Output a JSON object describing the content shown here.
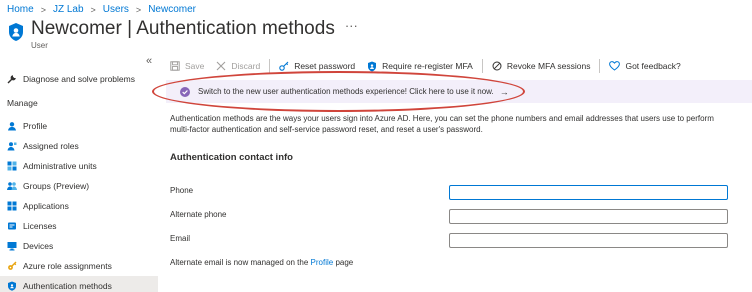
{
  "breadcrumb": [
    "Home",
    "JZ Lab",
    "Users",
    "Newcomer"
  ],
  "header": {
    "title": "Newcomer | Authentication methods",
    "ellipsis": "···",
    "subtitle": "User"
  },
  "collapse_glyph": "«",
  "sidebar": {
    "top_item": {
      "label": "Diagnose and solve problems",
      "icon": "wrench-icon"
    },
    "section": "Manage",
    "items": [
      {
        "label": "Profile",
        "icon": "profile-icon"
      },
      {
        "label": "Assigned roles",
        "icon": "assigned-roles-icon"
      },
      {
        "label": "Administrative units",
        "icon": "admin-units-icon"
      },
      {
        "label": "Groups (Preview)",
        "icon": "groups-icon"
      },
      {
        "label": "Applications",
        "icon": "applications-icon"
      },
      {
        "label": "Licenses",
        "icon": "licenses-icon"
      },
      {
        "label": "Devices",
        "icon": "devices-icon"
      },
      {
        "label": "Azure role assignments",
        "icon": "key-icon"
      },
      {
        "label": "Authentication methods",
        "icon": "shield-icon",
        "active": true
      }
    ]
  },
  "toolbar": {
    "save": "Save",
    "discard": "Discard",
    "reset_password": "Reset password",
    "require_mfa": "Require re-register MFA",
    "revoke_mfa": "Revoke MFA sessions",
    "feedback": "Got feedback?"
  },
  "banner": {
    "text": "Switch to the new user authentication methods experience! Click here to use it now.",
    "arrow": "→"
  },
  "description": "Authentication methods are the ways your users sign into Azure AD. Here, you can set the phone numbers and email addresses that users use to perform multi-factor authentication and self-service password reset, and reset a user's password.",
  "section_title": "Authentication contact info",
  "fields": {
    "phone": {
      "label": "Phone",
      "value": ""
    },
    "alternate_phone": {
      "label": "Alternate phone",
      "value": ""
    },
    "email": {
      "label": "Email",
      "value": ""
    }
  },
  "note": {
    "prefix": "Alternate email is now managed on the ",
    "link": "Profile",
    "suffix": " page"
  },
  "colors": {
    "link": "#0078d4",
    "banner_bg": "#f3effa",
    "banner_icon": "#8764b8",
    "annotation_oval": "#d0453b",
    "active_item_bg": "#edebe9"
  }
}
